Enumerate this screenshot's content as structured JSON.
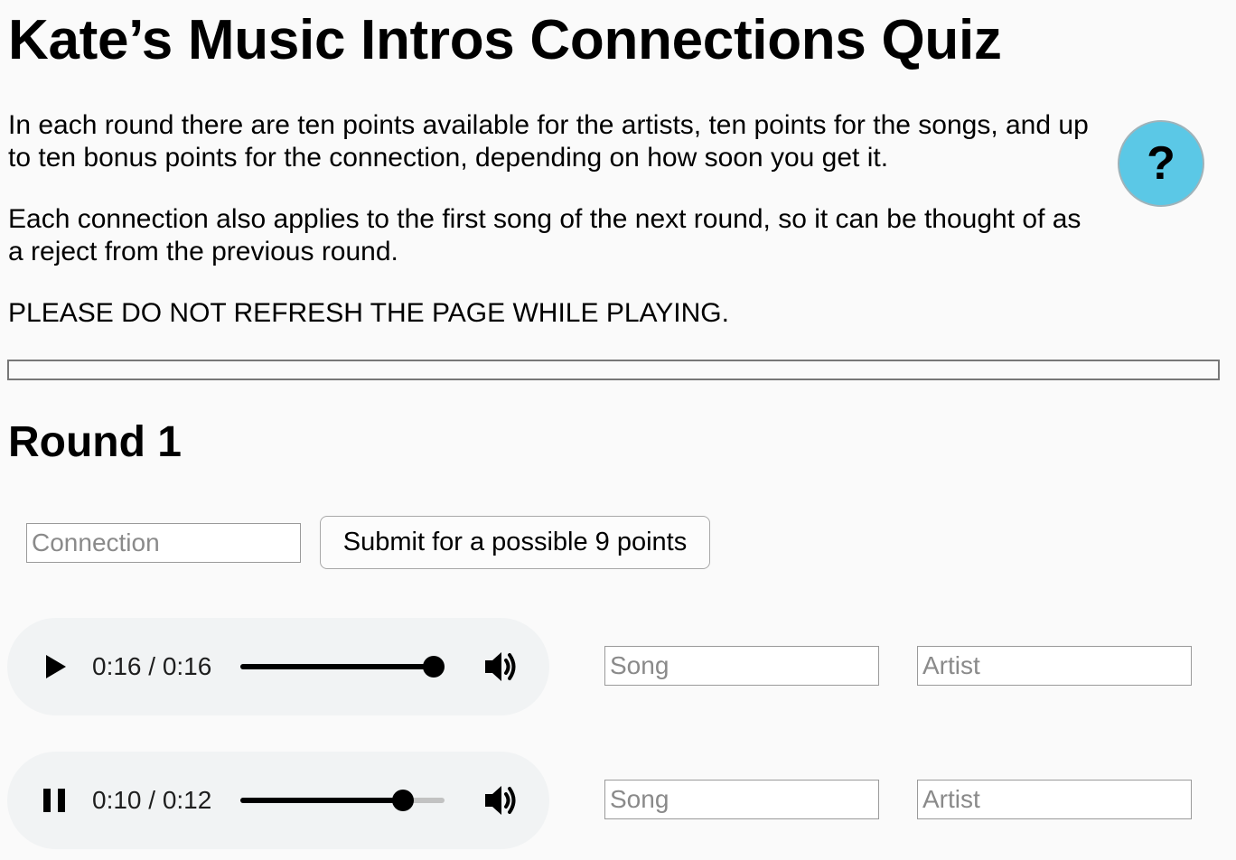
{
  "page": {
    "title": "Kate’s Music Intros Connections Quiz",
    "intro_paragraphs": [
      "In each round there are ten points available for the artists, ten points for the songs, and up to ten bonus points for the connection, depending on how soon you get it.",
      "Each connection also applies to the first song of the next round, so it can be thought of as a reject from the previous round.",
      "PLEASE DO NOT REFRESH THE PAGE WHILE PLAYING."
    ],
    "help_button": {
      "label": "?",
      "color": "#5bc8e6"
    }
  },
  "progress": {
    "fraction": 0
  },
  "round": {
    "heading": "Round 1",
    "connection": {
      "placeholder": "Connection",
      "value": ""
    },
    "submit_label": "Submit for a possible 9 points",
    "tracks": [
      {
        "state": "paused",
        "icon": "play-icon",
        "time_label": "0:16 / 0:16",
        "current_seconds": 16,
        "duration_seconds": 16,
        "song": {
          "placeholder": "Song",
          "value": ""
        },
        "artist": {
          "placeholder": "Artist",
          "value": ""
        }
      },
      {
        "state": "playing",
        "icon": "pause-icon",
        "time_label": "0:10 / 0:12",
        "current_seconds": 10,
        "duration_seconds": 12,
        "song": {
          "placeholder": "Song",
          "value": ""
        },
        "artist": {
          "placeholder": "Artist",
          "value": ""
        }
      }
    ]
  }
}
